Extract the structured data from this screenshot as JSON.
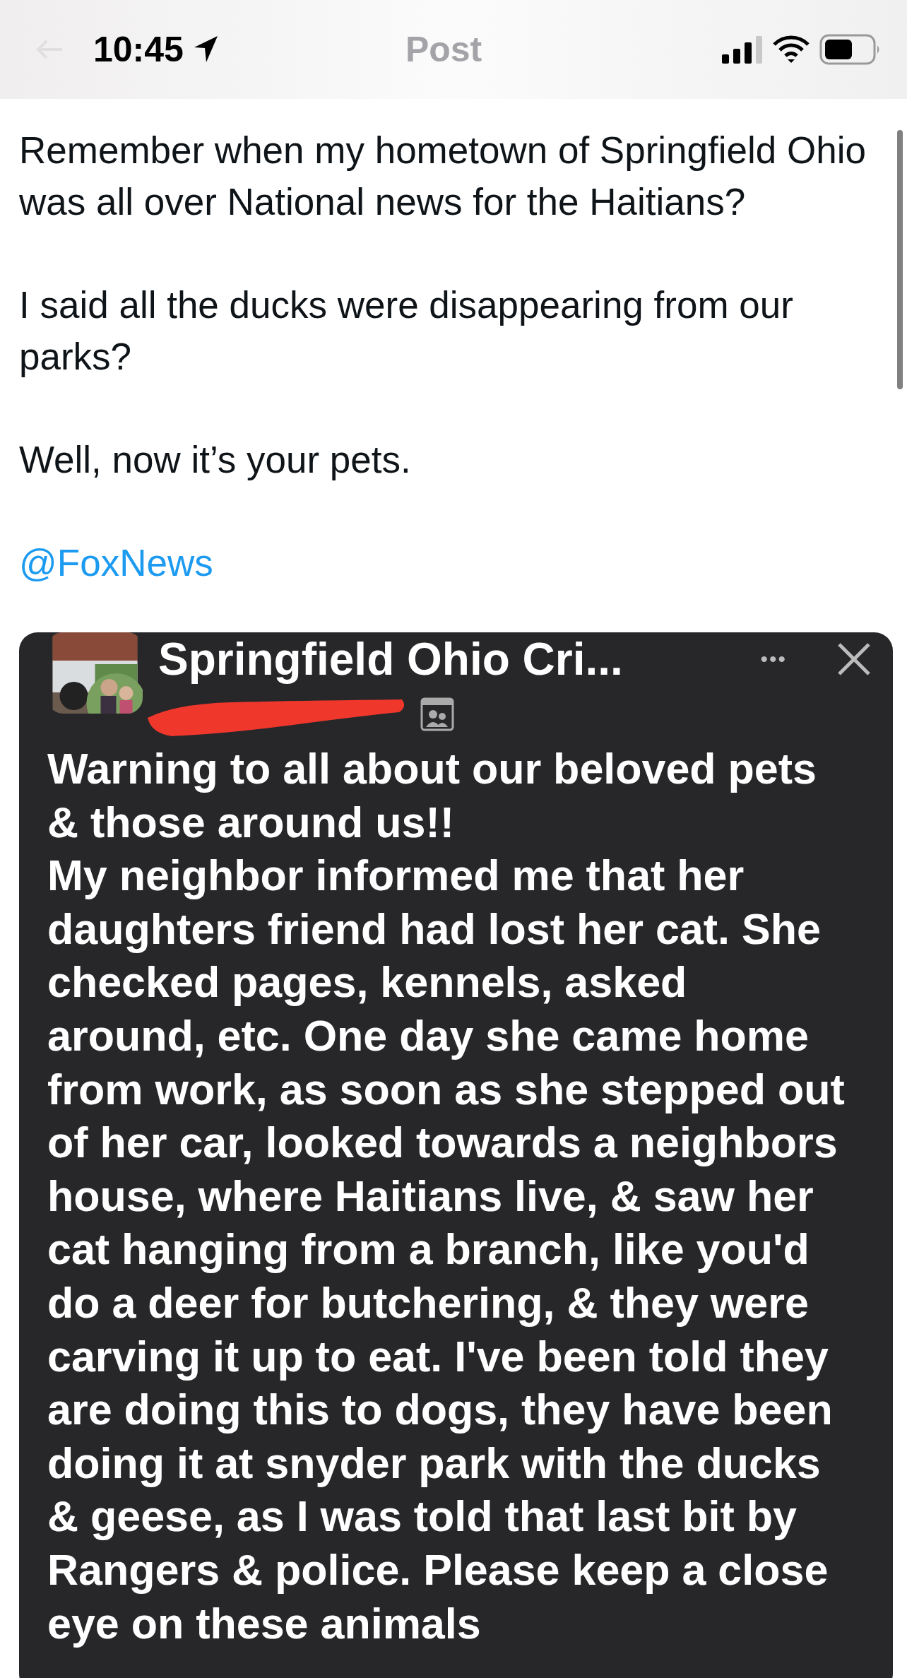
{
  "status_bar": {
    "time": "10:45"
  },
  "nav": {
    "title": "Post"
  },
  "post": {
    "paragraphs": [
      [
        "Remember when my hometown of Springfield Ohio",
        "was all over National news for the Haitians?"
      ],
      [
        "I said all the ducks were disappearing from our",
        "parks?"
      ],
      [
        "Well, now it’s your pets."
      ]
    ],
    "mention": "@FoxNews"
  },
  "embedded": {
    "group_name": "Springfield Ohio Cri...",
    "more": "•••",
    "paragraphs": [
      [
        "Warning to all about our beloved pets",
        "& those around us!!"
      ],
      [
        "My neighbor informed me that her",
        "daughters friend had lost her cat. She",
        "checked pages, kennels, asked",
        "around, etc. One day she came home",
        "from work, as soon as she stepped out",
        "of her car, looked towards a neighbors",
        "house, where Haitians live, & saw her",
        "cat hanging from a branch, like you'd",
        "do a deer for butchering, & they were",
        "carving it up to eat. I've been told they",
        "are doing this to dogs, they have been",
        "doing it at snyder park with the ducks",
        "& geese, as I was told that last bit by",
        "Rangers & police. Please keep a close",
        "eye on these animals"
      ]
    ]
  }
}
